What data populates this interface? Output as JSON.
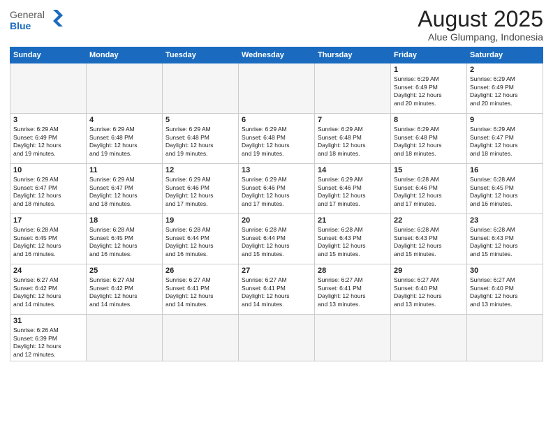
{
  "header": {
    "logo_general": "General",
    "logo_blue": "Blue",
    "title": "August 2025",
    "subtitle": "Alue Glumpang, Indonesia"
  },
  "days_header": [
    "Sunday",
    "Monday",
    "Tuesday",
    "Wednesday",
    "Thursday",
    "Friday",
    "Saturday"
  ],
  "weeks": [
    [
      {
        "day": "",
        "info": ""
      },
      {
        "day": "",
        "info": ""
      },
      {
        "day": "",
        "info": ""
      },
      {
        "day": "",
        "info": ""
      },
      {
        "day": "",
        "info": ""
      },
      {
        "day": "1",
        "info": "Sunrise: 6:29 AM\nSunset: 6:49 PM\nDaylight: 12 hours\nand 20 minutes."
      },
      {
        "day": "2",
        "info": "Sunrise: 6:29 AM\nSunset: 6:49 PM\nDaylight: 12 hours\nand 20 minutes."
      }
    ],
    [
      {
        "day": "3",
        "info": "Sunrise: 6:29 AM\nSunset: 6:49 PM\nDaylight: 12 hours\nand 19 minutes."
      },
      {
        "day": "4",
        "info": "Sunrise: 6:29 AM\nSunset: 6:48 PM\nDaylight: 12 hours\nand 19 minutes."
      },
      {
        "day": "5",
        "info": "Sunrise: 6:29 AM\nSunset: 6:48 PM\nDaylight: 12 hours\nand 19 minutes."
      },
      {
        "day": "6",
        "info": "Sunrise: 6:29 AM\nSunset: 6:48 PM\nDaylight: 12 hours\nand 19 minutes."
      },
      {
        "day": "7",
        "info": "Sunrise: 6:29 AM\nSunset: 6:48 PM\nDaylight: 12 hours\nand 18 minutes."
      },
      {
        "day": "8",
        "info": "Sunrise: 6:29 AM\nSunset: 6:48 PM\nDaylight: 12 hours\nand 18 minutes."
      },
      {
        "day": "9",
        "info": "Sunrise: 6:29 AM\nSunset: 6:47 PM\nDaylight: 12 hours\nand 18 minutes."
      }
    ],
    [
      {
        "day": "10",
        "info": "Sunrise: 6:29 AM\nSunset: 6:47 PM\nDaylight: 12 hours\nand 18 minutes."
      },
      {
        "day": "11",
        "info": "Sunrise: 6:29 AM\nSunset: 6:47 PM\nDaylight: 12 hours\nand 18 minutes."
      },
      {
        "day": "12",
        "info": "Sunrise: 6:29 AM\nSunset: 6:46 PM\nDaylight: 12 hours\nand 17 minutes."
      },
      {
        "day": "13",
        "info": "Sunrise: 6:29 AM\nSunset: 6:46 PM\nDaylight: 12 hours\nand 17 minutes."
      },
      {
        "day": "14",
        "info": "Sunrise: 6:29 AM\nSunset: 6:46 PM\nDaylight: 12 hours\nand 17 minutes."
      },
      {
        "day": "15",
        "info": "Sunrise: 6:28 AM\nSunset: 6:46 PM\nDaylight: 12 hours\nand 17 minutes."
      },
      {
        "day": "16",
        "info": "Sunrise: 6:28 AM\nSunset: 6:45 PM\nDaylight: 12 hours\nand 16 minutes."
      }
    ],
    [
      {
        "day": "17",
        "info": "Sunrise: 6:28 AM\nSunset: 6:45 PM\nDaylight: 12 hours\nand 16 minutes."
      },
      {
        "day": "18",
        "info": "Sunrise: 6:28 AM\nSunset: 6:45 PM\nDaylight: 12 hours\nand 16 minutes."
      },
      {
        "day": "19",
        "info": "Sunrise: 6:28 AM\nSunset: 6:44 PM\nDaylight: 12 hours\nand 16 minutes."
      },
      {
        "day": "20",
        "info": "Sunrise: 6:28 AM\nSunset: 6:44 PM\nDaylight: 12 hours\nand 15 minutes."
      },
      {
        "day": "21",
        "info": "Sunrise: 6:28 AM\nSunset: 6:43 PM\nDaylight: 12 hours\nand 15 minutes."
      },
      {
        "day": "22",
        "info": "Sunrise: 6:28 AM\nSunset: 6:43 PM\nDaylight: 12 hours\nand 15 minutes."
      },
      {
        "day": "23",
        "info": "Sunrise: 6:28 AM\nSunset: 6:43 PM\nDaylight: 12 hours\nand 15 minutes."
      }
    ],
    [
      {
        "day": "24",
        "info": "Sunrise: 6:27 AM\nSunset: 6:42 PM\nDaylight: 12 hours\nand 14 minutes."
      },
      {
        "day": "25",
        "info": "Sunrise: 6:27 AM\nSunset: 6:42 PM\nDaylight: 12 hours\nand 14 minutes."
      },
      {
        "day": "26",
        "info": "Sunrise: 6:27 AM\nSunset: 6:41 PM\nDaylight: 12 hours\nand 14 minutes."
      },
      {
        "day": "27",
        "info": "Sunrise: 6:27 AM\nSunset: 6:41 PM\nDaylight: 12 hours\nand 14 minutes."
      },
      {
        "day": "28",
        "info": "Sunrise: 6:27 AM\nSunset: 6:41 PM\nDaylight: 12 hours\nand 13 minutes."
      },
      {
        "day": "29",
        "info": "Sunrise: 6:27 AM\nSunset: 6:40 PM\nDaylight: 12 hours\nand 13 minutes."
      },
      {
        "day": "30",
        "info": "Sunrise: 6:27 AM\nSunset: 6:40 PM\nDaylight: 12 hours\nand 13 minutes."
      }
    ],
    [
      {
        "day": "31",
        "info": "Sunrise: 6:26 AM\nSunset: 6:39 PM\nDaylight: 12 hours\nand 12 minutes."
      },
      {
        "day": "",
        "info": ""
      },
      {
        "day": "",
        "info": ""
      },
      {
        "day": "",
        "info": ""
      },
      {
        "day": "",
        "info": ""
      },
      {
        "day": "",
        "info": ""
      },
      {
        "day": "",
        "info": ""
      }
    ]
  ]
}
